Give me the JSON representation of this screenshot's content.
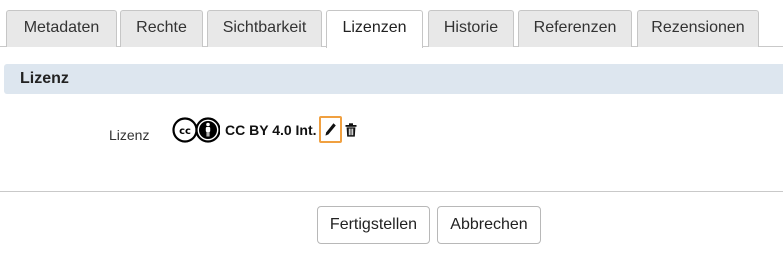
{
  "tabs": [
    {
      "label": "Metadaten",
      "active": false
    },
    {
      "label": "Rechte",
      "active": false
    },
    {
      "label": "Sichtbarkeit",
      "active": false
    },
    {
      "label": "Lizenzen",
      "active": true
    },
    {
      "label": "Historie",
      "active": false
    },
    {
      "label": "Referenzen",
      "active": false
    },
    {
      "label": "Rezensionen",
      "active": false
    }
  ],
  "section": {
    "title": "Lizenz"
  },
  "license": {
    "field_label": "Lizenz",
    "value": "CC BY 4.0 Int.",
    "logo_icons": [
      "cc-icon",
      "by-attribution-icon"
    ],
    "edit_icon": "pencil-icon",
    "delete_icon": "trash-icon"
  },
  "buttons": {
    "finish_label": "Fertigstellen",
    "cancel_label": "Abbrechen"
  },
  "colors": {
    "tab_background": "#e8e8e8",
    "section_header_background": "#dde6ef",
    "edit_highlight": "#f0a040"
  }
}
